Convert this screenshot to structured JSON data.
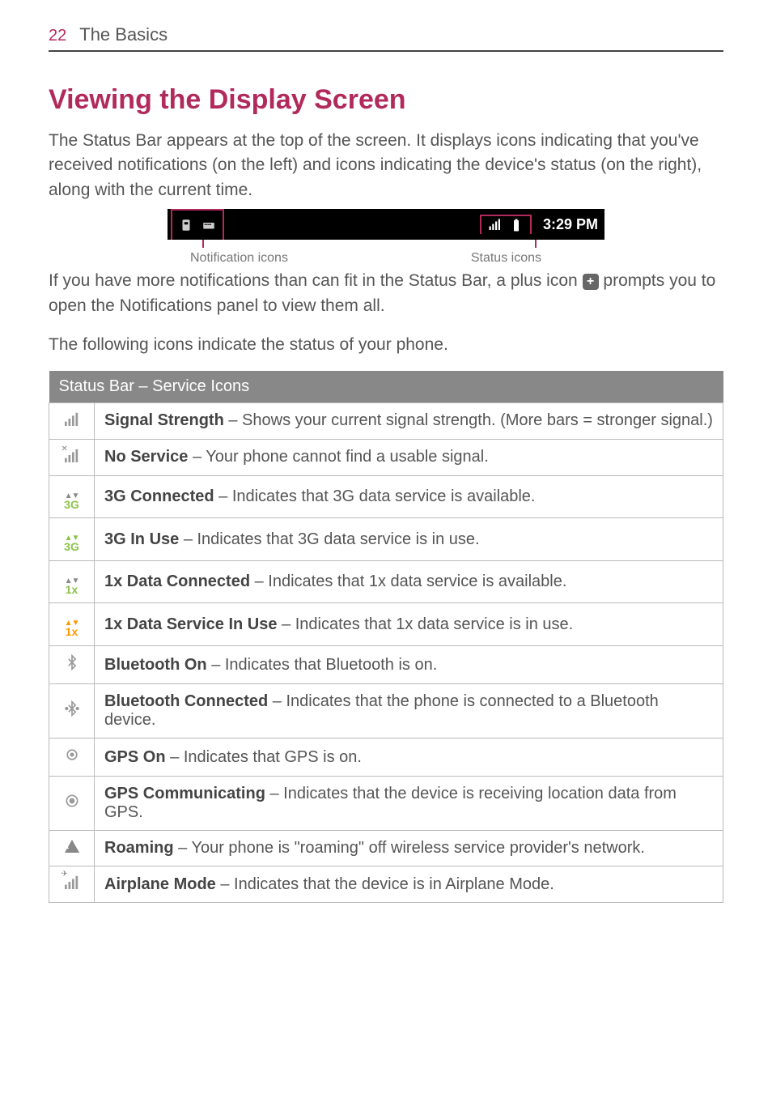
{
  "page": {
    "number": "22",
    "section": "The Basics"
  },
  "title": "Viewing the Display Screen",
  "intro": "The Status Bar appears at the top of the screen. It displays icons indicating that you've received notifications (on the left) and icons indicating the device's status (on the right), along with the current time.",
  "statusbar": {
    "time": "3:29 PM",
    "caption_left": "Notification icons",
    "caption_right": "Status icons"
  },
  "para2_a": "If you have more notifications than can fit in the Status Bar, a plus icon ",
  "para2_b": " prompts you to open the Notifications panel to view them all.",
  "para3": "The following icons indicate the status of your phone.",
  "table": {
    "header": "Status Bar – Service Icons",
    "rows": [
      {
        "icon": "signal",
        "term": "Signal Strength",
        "desc": " – Shows your current signal strength. (More bars = stronger signal.)"
      },
      {
        "icon": "no-service",
        "term": "No Service",
        "desc": " – Your phone cannot find a usable signal."
      },
      {
        "icon": "3g-conn",
        "term": "3G Connected",
        "desc": " – Indicates that 3G data service is available."
      },
      {
        "icon": "3g-use",
        "term": "3G In Use",
        "desc": " – Indicates that 3G data service is in use."
      },
      {
        "icon": "1x-conn",
        "term": "1x Data Connected",
        "desc": " – Indicates that 1x data service is available."
      },
      {
        "icon": "1x-use",
        "term": "1x Data Service In Use",
        "desc": " – Indicates that 1x data service is in use."
      },
      {
        "icon": "bt-on",
        "term": "Bluetooth On",
        "desc": " – Indicates that Bluetooth is on."
      },
      {
        "icon": "bt-conn",
        "term": "Bluetooth Connected",
        "desc": " – Indicates that the phone is connected to a Bluetooth device."
      },
      {
        "icon": "gps-on",
        "term": "GPS On",
        "desc": " – Indicates that GPS is on."
      },
      {
        "icon": "gps-comm",
        "term": "GPS Communicating",
        "desc": " – Indicates that the device is receiving location data from GPS."
      },
      {
        "icon": "roaming",
        "term": "Roaming",
        "desc": " – Your phone is \"roaming\" off wireless service provider's network."
      },
      {
        "icon": "airplane",
        "term": "Airplane Mode",
        "desc": " – Indicates that the device is in Airplane Mode."
      }
    ]
  }
}
